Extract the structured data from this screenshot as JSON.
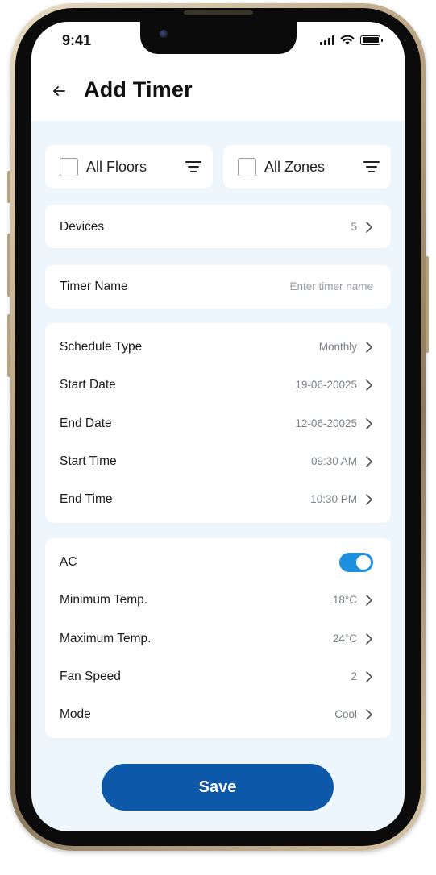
{
  "status_bar": {
    "time": "9:41"
  },
  "header": {
    "title": "Add Timer"
  },
  "filters": {
    "floors_label": "All Floors",
    "zones_label": "All Zones"
  },
  "devices": {
    "label": "Devices",
    "value": "5"
  },
  "timer_name": {
    "label": "Timer Name",
    "placeholder": "Enter timer name",
    "value": ""
  },
  "schedule": {
    "items": [
      {
        "label": "Schedule Type",
        "value": "Monthly"
      },
      {
        "label": "Start Date",
        "value": "19-06-20025"
      },
      {
        "label": "End Date",
        "value": "12-06-20025"
      },
      {
        "label": "Start Time",
        "value": "09:30 AM"
      },
      {
        "label": "End Time",
        "value": "10:30 PM"
      }
    ]
  },
  "ac": {
    "label": "AC",
    "enabled": true,
    "items": [
      {
        "label": "Minimum Temp.",
        "value": "18°C"
      },
      {
        "label": "Maximum Temp.",
        "value": "24°C"
      },
      {
        "label": "Fan Speed",
        "value": "2"
      },
      {
        "label": "Mode",
        "value": "Cool"
      }
    ]
  },
  "actions": {
    "save_label": "Save"
  },
  "colors": {
    "primary": "#0d58a8",
    "toggle_on": "#1e90e0",
    "screen_bg": "#eef6fd"
  },
  "icons": [
    "back-arrow-icon",
    "filter-icon",
    "chevron-right-icon",
    "checkbox-icon",
    "signal-icon",
    "wifi-icon",
    "battery-icon"
  ]
}
